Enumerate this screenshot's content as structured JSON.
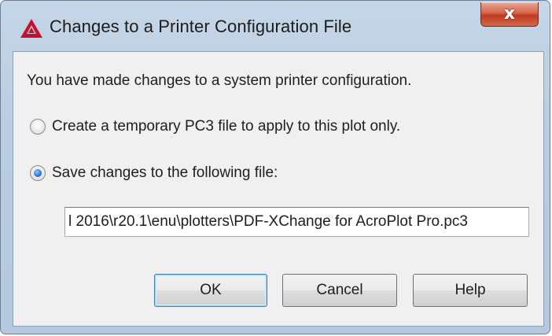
{
  "window": {
    "title": "Changes to a Printer Configuration File",
    "app_icon": "autocad-logo-icon",
    "close_icon": "close-icon",
    "close_label": "x"
  },
  "body": {
    "message": "You have made changes to a system printer configuration.",
    "options": [
      {
        "label": "Create a temporary PC3 file to apply to this plot only.",
        "checked": false
      },
      {
        "label": "Save changes to the following file:",
        "checked": true
      }
    ],
    "file_path": "l 2016\\r20.1\\enu\\plotters\\PDF-XChange for AcroPlot Pro.pc3"
  },
  "buttons": {
    "ok": "OK",
    "cancel": "Cancel",
    "help": "Help"
  },
  "colors": {
    "titlebar": "#b9cce2",
    "close_button": "#c23a20",
    "client_bg": "#f0f0f0",
    "default_button_border": "#3c7fb1",
    "logo_red": "#c8102e"
  }
}
